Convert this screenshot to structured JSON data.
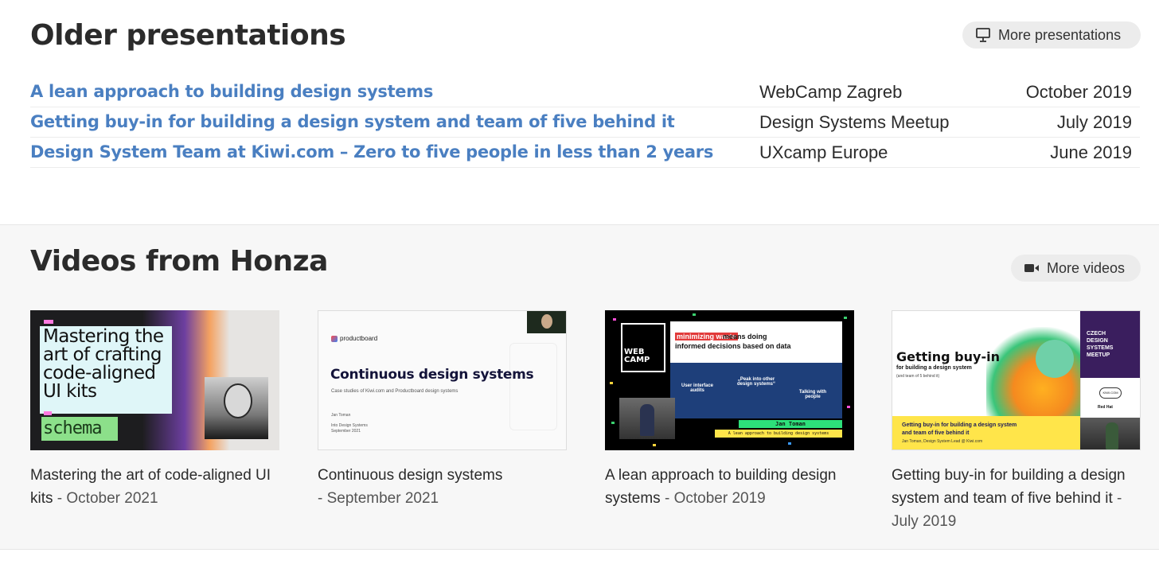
{
  "presentations": {
    "heading": "Older presentations",
    "more_label": "More presentations",
    "more_icon": "presentation-icon",
    "rows": [
      {
        "title": "A lean approach to building design systems",
        "event": "WebCamp Zagreb",
        "date": "October 2019"
      },
      {
        "title": "Getting buy-in for building a design system and team of five behind it",
        "event": "Design Systems Meetup",
        "date": "July 2019"
      },
      {
        "title": "Design System Team at Kiwi.com – Zero to five people in less than 2 years",
        "event": "UXcamp Europe",
        "date": "June 2019"
      }
    ]
  },
  "videos": {
    "heading": "Videos from Honza",
    "more_label": "More videos",
    "more_icon": "video-camera-icon",
    "items": [
      {
        "title": "Mastering the art of code-aligned UI kits",
        "date": "- October 2021",
        "thumb": {
          "text": "Mastering the art of crafting code-aligned UI kits",
          "badge": "schema"
        }
      },
      {
        "title": "Continuous design systems",
        "date": "- September 2021",
        "thumb": {
          "logo": "productboard",
          "title": "Continuous design systems",
          "sub": "Case studies of Kiwi.com and Productboard design systems",
          "meta1": "Jan Toman",
          "meta2": "Into Design Systems",
          "meta3": "September 2021"
        }
      },
      {
        "title": "A lean approach to building design systems",
        "date": "- October 2019",
        "thumb": {
          "logo": "WEB CAMP",
          "highlight": "minimizing waste",
          "line1": "means doing",
          "line2": "informed decisions based on data",
          "box1": "User interface audits",
          "box2": "„Peak into other design systems“",
          "box3": "Talking with people",
          "name": "Jan Toman",
          "talk": "A lean approach to building design systems"
        }
      },
      {
        "title": "Getting buy-in for building a design system and team of five behind it",
        "date": "- July 2019",
        "thumb": {
          "title": "Getting buy-in",
          "sub": "for building a design system",
          "sub2": "(and team of 5 behind it)",
          "czech": "CZECH DESIGN SYSTEMS MEETUP",
          "kiwi": "KIWI.COM",
          "redhat": "Red Hat",
          "banner1": "Getting buy-in for building a design system",
          "banner2": "and team of five behind it",
          "banner3": "Jan Toman, Design System Lead @ Kiwi.com"
        }
      }
    ]
  },
  "colors": {
    "link": "#4a7fc1",
    "heading": "#2b2b2b",
    "pill_bg": "#ececec",
    "videos_bg": "#f7f7f7"
  }
}
